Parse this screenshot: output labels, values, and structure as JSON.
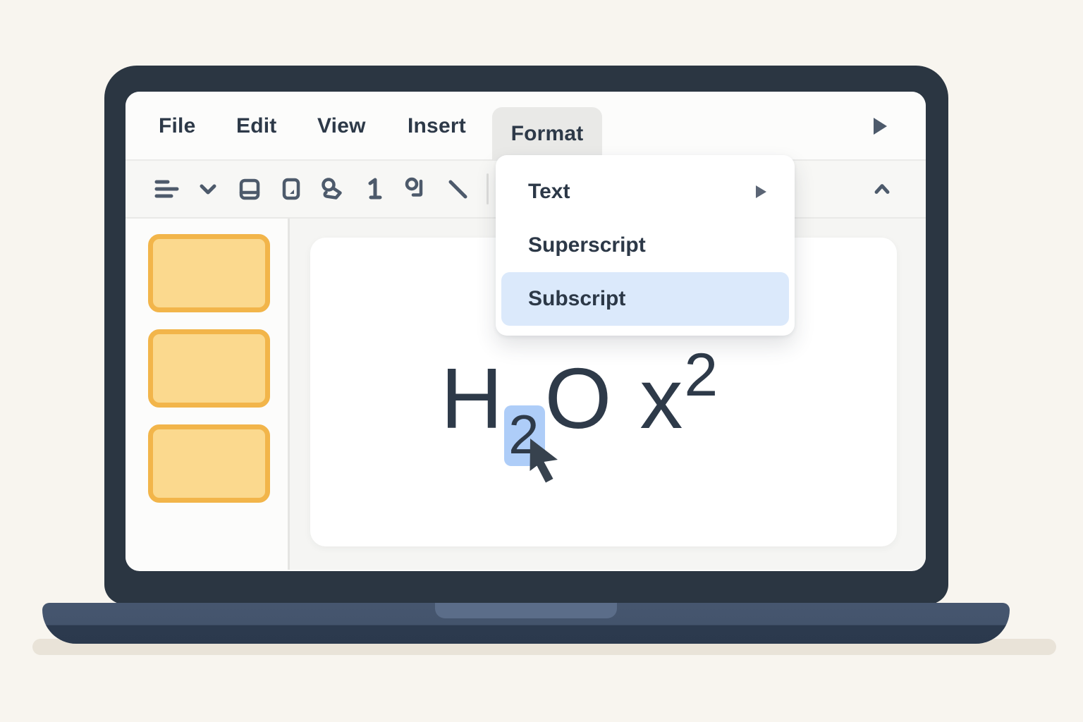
{
  "menu_bar": {
    "items": [
      {
        "label": "File"
      },
      {
        "label": "Edit"
      },
      {
        "label": "View"
      },
      {
        "label": "Insert"
      },
      {
        "label": "Format"
      }
    ],
    "active_item": "Format",
    "overflow_icon": "play-triangle-right"
  },
  "toolbar": {
    "icons": [
      "align-lines-icon",
      "chevron-down-icon",
      "slide-landscape-icon",
      "slide-portrait-icon",
      "lasso-shape-icon",
      "numeral-one-icon",
      "ink-pen-icon",
      "diagonal-line-icon"
    ],
    "right_icon": "chevron-up-icon"
  },
  "format_menu": {
    "items": [
      {
        "label": "Text",
        "has_submenu": true,
        "highlighted": false
      },
      {
        "label": "Superscript",
        "has_submenu": false,
        "highlighted": false
      },
      {
        "label": "Subscript",
        "has_submenu": false,
        "highlighted": true
      }
    ]
  },
  "slide_panel": {
    "thumbnail_count": 3
  },
  "canvas": {
    "formula": {
      "h": "H",
      "subscript": "2",
      "o": "O",
      "x": "x",
      "superscript": "2"
    },
    "selection": "subscript-2"
  },
  "colors": {
    "background": "#f8f5ef",
    "laptop_frame": "#2b3642",
    "laptop_base_top": "#44546c",
    "laptop_base_bottom": "#2b394d",
    "laptop_notch": "#5b6d89",
    "floor_shadow": "#e9e3d8",
    "screen": "#fcfcfb",
    "toolbar_bg": "#f7f7f5",
    "active_tab_bg": "#e9e9e7",
    "menu_text": "#2d3948",
    "icon": "#4d5a6b",
    "dropdown_highlight": "#dbe9fb",
    "selection_blue": "#aecdf8",
    "thumbnail_fill": "#fbd98e",
    "thumbnail_border": "#f2b54a",
    "formula_text": "#2e3a49"
  }
}
